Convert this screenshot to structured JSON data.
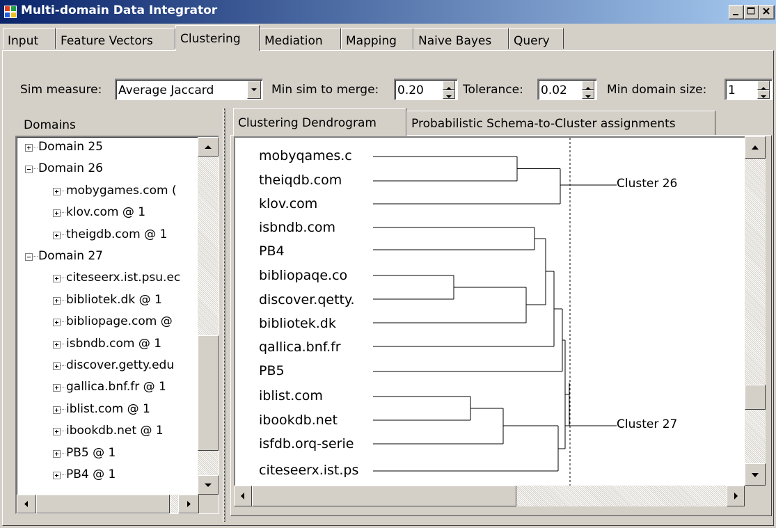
{
  "window": {
    "title": "Multi-domain Data Integrator"
  },
  "tabs": [
    "Input",
    "Feature Vectors",
    "Clustering",
    "Mediation",
    "Mapping",
    "Naive Bayes",
    "Query"
  ],
  "active_tab": "Clustering",
  "controls": {
    "sim_measure_label": "Sim measure:",
    "sim_measure_value": "Average Jaccard",
    "min_sim_label": "Min sim to merge:",
    "min_sim_value": "0.20",
    "tolerance_label": "Tolerance:",
    "tolerance_value": "0.02",
    "min_domain_label": "Min domain size:",
    "min_domain_value": "1"
  },
  "domains_panel": {
    "label": "Domains",
    "tree": [
      {
        "text": "Domain 25",
        "level": 0,
        "state": "collapsed"
      },
      {
        "text": "Domain 26",
        "level": 0,
        "state": "expanded"
      },
      {
        "text": "mobygames.com (",
        "level": 1,
        "state": "collapsed"
      },
      {
        "text": "klov.com @ 1",
        "level": 1,
        "state": "collapsed"
      },
      {
        "text": "theigdb.com @ 1",
        "level": 1,
        "state": "collapsed"
      },
      {
        "text": "Domain 27",
        "level": 0,
        "state": "expanded"
      },
      {
        "text": "citeseerx.ist.psu.ec",
        "level": 1,
        "state": "collapsed"
      },
      {
        "text": "bibliotek.dk @ 1",
        "level": 1,
        "state": "collapsed"
      },
      {
        "text": "bibliopage.com @",
        "level": 1,
        "state": "collapsed"
      },
      {
        "text": "isbndb.com @ 1",
        "level": 1,
        "state": "collapsed"
      },
      {
        "text": "discover.getty.edu",
        "level": 1,
        "state": "collapsed"
      },
      {
        "text": "gallica.bnf.fr @ 1",
        "level": 1,
        "state": "collapsed"
      },
      {
        "text": "iblist.com @ 1",
        "level": 1,
        "state": "collapsed"
      },
      {
        "text": "ibookdb.net @ 1",
        "level": 1,
        "state": "collapsed"
      },
      {
        "text": "PB5 @ 1",
        "level": 1,
        "state": "collapsed"
      },
      {
        "text": "PB4 @ 1",
        "level": 1,
        "state": "collapsed"
      }
    ]
  },
  "subtabs": [
    "Clustering Dendrogram",
    "Probabilistic Schema-to-Cluster assignments"
  ],
  "active_subtab": "Clustering Dendrogram",
  "dendrogram": {
    "leaves": [
      "mobyqames.c",
      "theiqdb.com",
      "klov.com",
      "isbndb.com",
      "PB4",
      "bibliopaqe.co",
      "discover.qetty.",
      "bibliotek.dk",
      "qallica.bnf.fr",
      "PB5",
      "iblist.com",
      "ibookdb.net",
      "isfdb.orq-serie",
      "citeseerx.ist.ps"
    ],
    "clusters": [
      "Cluster 26",
      "Cluster 27"
    ]
  }
}
